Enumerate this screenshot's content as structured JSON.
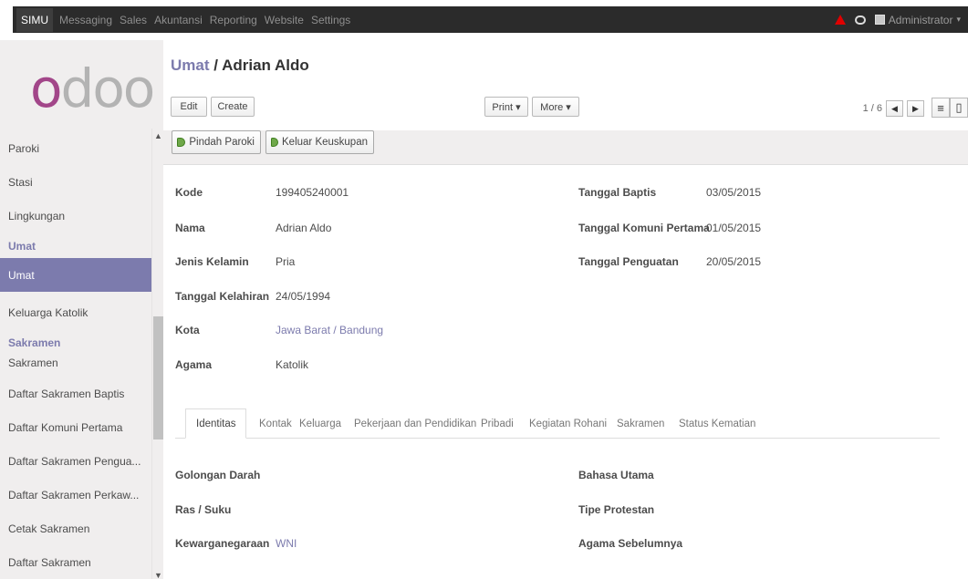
{
  "topbar": {
    "brand": "SIMU",
    "menu": [
      "Messaging",
      "Sales",
      "Akuntansi",
      "Reporting",
      "Website",
      "Settings"
    ],
    "user": "Administrator"
  },
  "sidebar": {
    "logo_first": "o",
    "logo_rest": "doo",
    "items": [
      {
        "label": "Paroki",
        "type": "item"
      },
      {
        "label": "Stasi",
        "type": "item"
      },
      {
        "label": "Lingkungan",
        "type": "item"
      },
      {
        "label": "Umat",
        "type": "heading"
      },
      {
        "label": "Umat",
        "type": "active"
      },
      {
        "label": "Keluarga Katolik",
        "type": "item"
      },
      {
        "label": "Sakramen",
        "type": "heading"
      },
      {
        "label": "Sakramen",
        "type": "item"
      },
      {
        "label": "Daftar Sakramen Baptis",
        "type": "item"
      },
      {
        "label": "Daftar Komuni Pertama",
        "type": "item"
      },
      {
        "label": "Daftar Sakramen Pengua...",
        "type": "item"
      },
      {
        "label": "Daftar Sakramen Perkaw...",
        "type": "item"
      },
      {
        "label": "Cetak Sakramen",
        "type": "item"
      },
      {
        "label": "Daftar Sakramen",
        "type": "item"
      }
    ]
  },
  "header": {
    "breadcrumb_parent": "Umat",
    "breadcrumb_sep": " / ",
    "breadcrumb_current": "Adrian Aldo",
    "edit_label": "Edit",
    "create_label": "Create",
    "print_label": "Print ▾",
    "more_label": "More ▾",
    "pager": "1 / 6"
  },
  "actions": {
    "pindah_paroki": "Pindah Paroki",
    "keluar_keuskupan": "Keluar Keuskupan"
  },
  "form": {
    "left": [
      {
        "label": "Kode",
        "value": "199405240001"
      },
      {
        "label": "Nama",
        "value": "Adrian Aldo"
      },
      {
        "label": "Jenis Kelamin",
        "value": "Pria"
      },
      {
        "label": "Tanggal Kelahiran",
        "value": "24/05/1994"
      },
      {
        "label": "Kota",
        "value": "Jawa Barat / Bandung"
      },
      {
        "label": "Agama",
        "value": "Katolik"
      }
    ],
    "right": [
      {
        "label": "Tanggal Baptis",
        "value": "03/05/2015"
      },
      {
        "label": "Tanggal Komuni Pertama",
        "value": "01/05/2015"
      },
      {
        "label": "Tanggal Penguatan",
        "value": "20/05/2015"
      }
    ]
  },
  "tabs": [
    "Identitas",
    "Kontak",
    "Keluarga",
    "Pekerjaan dan Pendidikan",
    "Pribadi",
    "Kegiatan Rohani",
    "Sakramen",
    "Status Kematian"
  ],
  "identitas": {
    "left": [
      {
        "label": "Golongan Darah",
        "value": ""
      },
      {
        "label": "Ras / Suku",
        "value": ""
      },
      {
        "label": "Kewarganegaraan",
        "value": "WNI"
      }
    ],
    "right": [
      {
        "label": "Bahasa Utama",
        "value": ""
      },
      {
        "label": "Tipe Protestan",
        "value": ""
      },
      {
        "label": "Agama Sebelumnya",
        "value": ""
      }
    ]
  },
  "colors": {
    "accent": "#7c7bad",
    "topbar": "#2b2b2b",
    "logo_o": "#a24689"
  }
}
